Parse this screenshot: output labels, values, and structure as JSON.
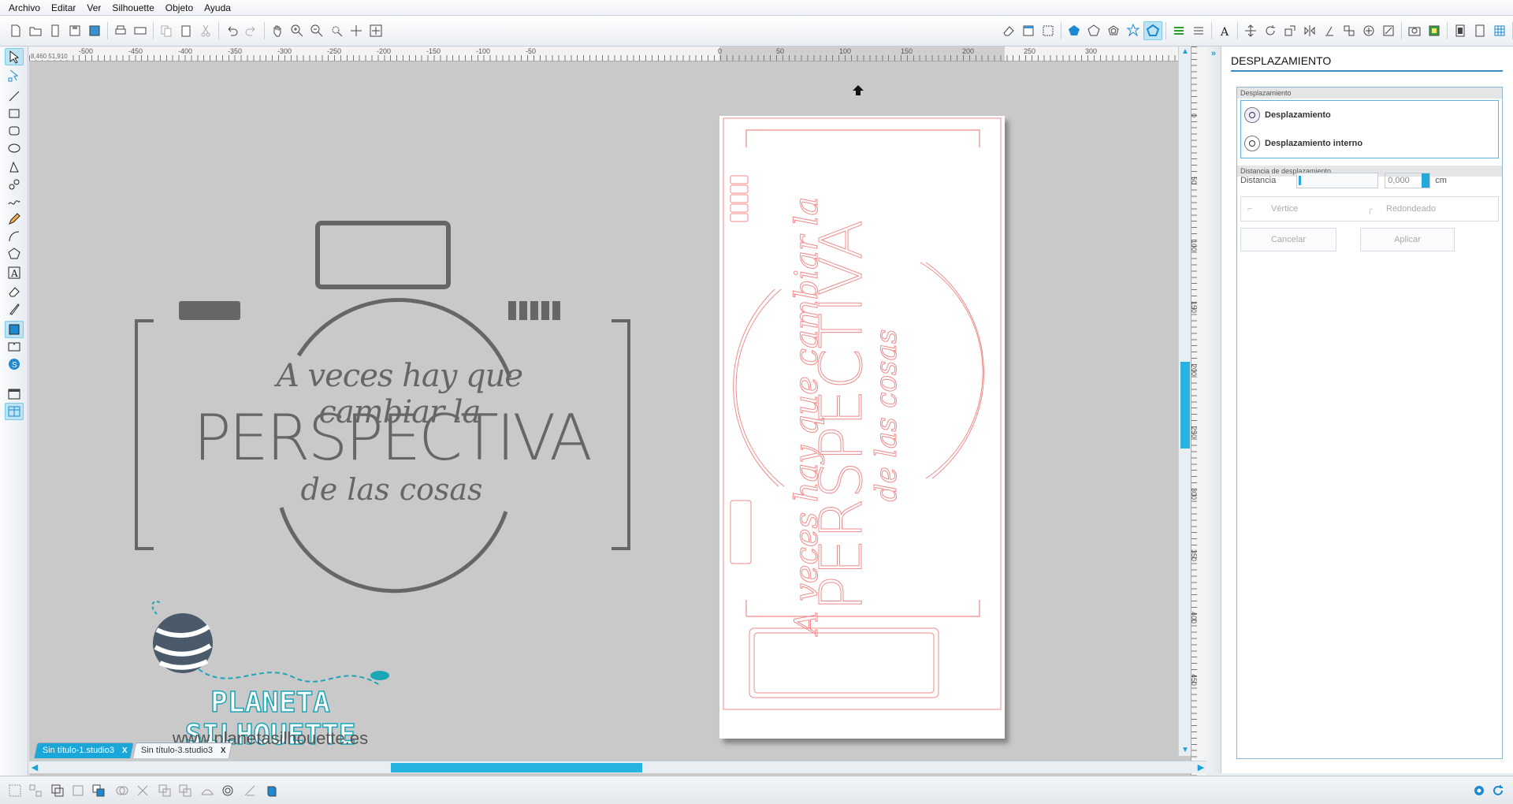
{
  "menu": [
    "Archivo",
    "Editar",
    "Ver",
    "Silhouette",
    "Objeto",
    "Ayuda"
  ],
  "ruler": {
    "h_labels": [
      "-500",
      "-450",
      "-400",
      "-350",
      "-300",
      "-250",
      "-200",
      "-150",
      "-100",
      "-50",
      "0",
      "50",
      "100",
      "150",
      "200",
      "250",
      "300"
    ],
    "v_labels": [
      "0",
      "50",
      "100",
      "150",
      "200",
      "250",
      "300",
      "350",
      "400",
      "450"
    ],
    "coord": "8,460   51,910"
  },
  "design": {
    "line1": "A veces hay que cambiar la",
    "line2": "PERSPECTIVA",
    "line3": "de las cosas",
    "brand": "PLANETA SILHOUETTE",
    "url": "www.planetasilhouette.es"
  },
  "tabs": [
    {
      "label": "Sin título-1.studio3",
      "close": "X",
      "active": true
    },
    {
      "label": "Sin título-3.studio3",
      "close": "X",
      "active": false
    }
  ],
  "panel": {
    "title": "DESPLAZAMIENTO",
    "section1": "Desplazamiento",
    "opt_offset": "Desplazamiento",
    "opt_inner": "Desplazamiento interno",
    "section2": "Distancia de desplazamiento",
    "distance_label": "Distancia",
    "distance_value": "0,000",
    "unit": "cm",
    "corner_vertex": "Vértice",
    "corner_round": "Redondeado",
    "cancel": "Cancelar",
    "apply": "Aplicar"
  },
  "colors": {
    "accent": "#1ba6d9",
    "cut_line": "#f08a8a",
    "design_gray": "#666666"
  }
}
